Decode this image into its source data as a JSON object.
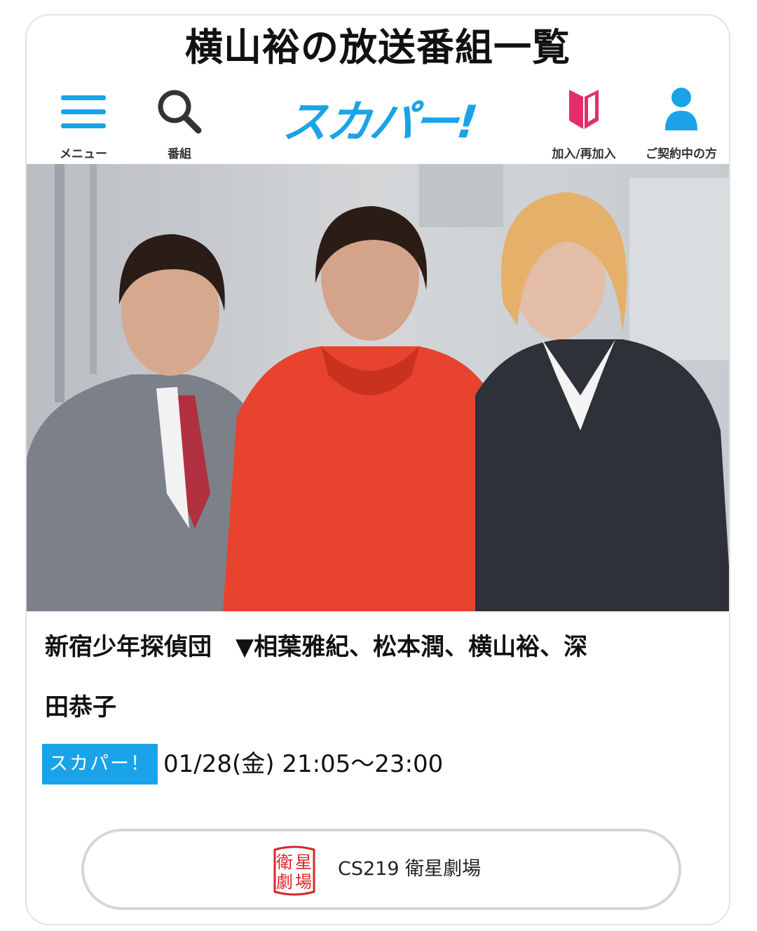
{
  "page": {
    "title": "横山裕の放送番組一覧"
  },
  "nav": {
    "menu_label": "メニュー",
    "search_label": "番組",
    "logo_text": "スカパー!",
    "join_label": "加入/再加入",
    "account_label": "ご契約中の方"
  },
  "program": {
    "title_line1": "新宿少年探偵団　▼相葉雅紀、松本潤、横山裕、深",
    "title_line2": "田恭子"
  },
  "schedule": {
    "badge": "スカパー！",
    "datetime": "01/28(金) 21:05～23:00"
  },
  "channel": {
    "logo_chars": [
      "衛",
      "星",
      "劇",
      "場"
    ],
    "label": "CS219 衛星劇場"
  },
  "colors": {
    "accent": "#1aa3e8",
    "join_icon": "#e0306a",
    "channel_logo": "#d9262a"
  }
}
